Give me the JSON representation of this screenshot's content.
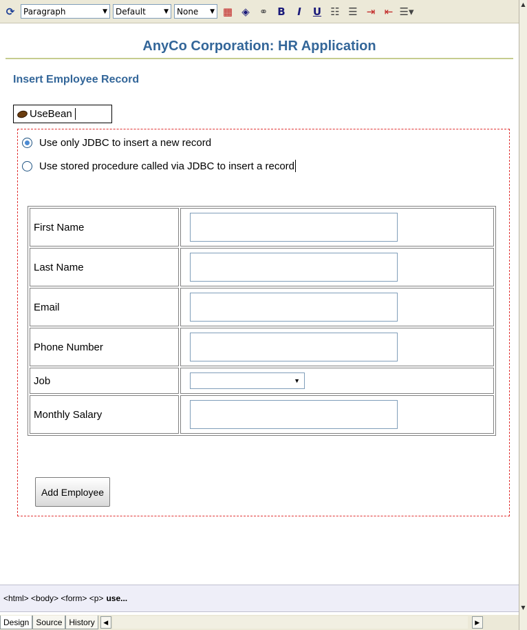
{
  "toolbar": {
    "format_value": "Paragraph",
    "font_value": "Default",
    "size_value": "None",
    "bold": "B",
    "italic": "I",
    "underline": "U"
  },
  "page": {
    "heading": "AnyCo Corporation: HR Application",
    "subheading": "Insert Employee Record",
    "usebean_label": "UseBean"
  },
  "form": {
    "radio_jdbc": "Use only JDBC to insert a new record",
    "radio_stored": "Use stored procedure called via JDBC to insert a record",
    "fields": [
      {
        "label": "First Name"
      },
      {
        "label": "Last Name"
      },
      {
        "label": "Email"
      },
      {
        "label": "Phone Number"
      },
      {
        "label": "Job"
      },
      {
        "label": "Monthly Salary"
      }
    ],
    "submit_label": "Add Employee"
  },
  "status": {
    "path": "<html> <body> <form> <p>",
    "current": "use..."
  },
  "tabs": [
    "Design",
    "Source",
    "History"
  ],
  "colors": {
    "heading": "#336699",
    "rule": "#c5cc8f",
    "form_border": "#e03030"
  }
}
